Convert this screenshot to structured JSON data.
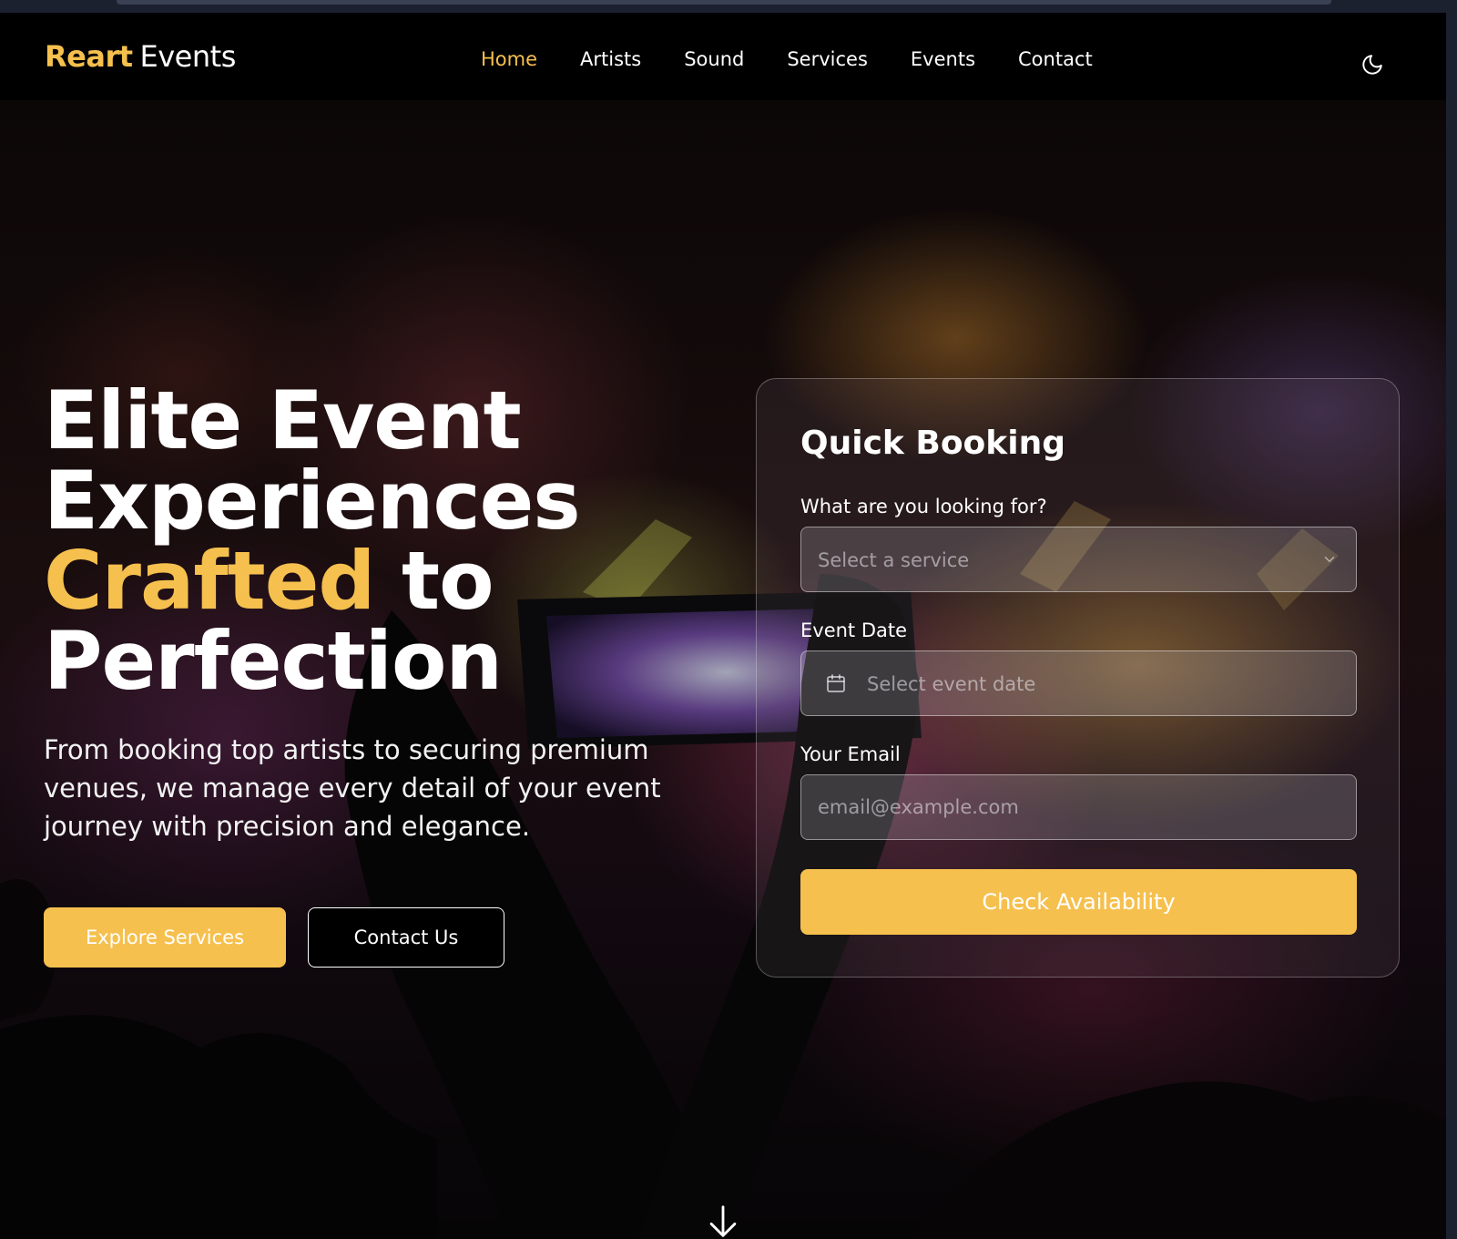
{
  "brand": {
    "name": "Reart",
    "suffix": "Events"
  },
  "nav": {
    "links": [
      {
        "label": "Home",
        "active": true
      },
      {
        "label": "Artists",
        "active": false
      },
      {
        "label": "Sound",
        "active": false
      },
      {
        "label": "Services",
        "active": false
      },
      {
        "label": "Events",
        "active": false
      },
      {
        "label": "Contact",
        "active": false
      }
    ],
    "theme_toggle_icon": "moon-icon"
  },
  "hero": {
    "title_line1": "Elite Event",
    "title_line2": "Experiences",
    "title_accent": "Crafted",
    "title_line3_rest": "to",
    "title_line4": "Perfection",
    "subtitle": "From booking top artists to securing premium venues, we manage every detail of your event journey with precision and elegance.",
    "primary_button": "Explore Services",
    "secondary_button": "Contact Us",
    "scroll_icon": "arrow-down-icon"
  },
  "booking": {
    "title": "Quick Booking",
    "service_label": "What are you looking for?",
    "service_placeholder": "Select a service",
    "date_label": "Event Date",
    "date_placeholder": "Select event date",
    "email_label": "Your Email",
    "email_placeholder": "email@example.com",
    "submit": "Check Availability"
  },
  "colors": {
    "accent": "#f5c04e",
    "nav_background": "#000000",
    "text": "#ffffff"
  }
}
